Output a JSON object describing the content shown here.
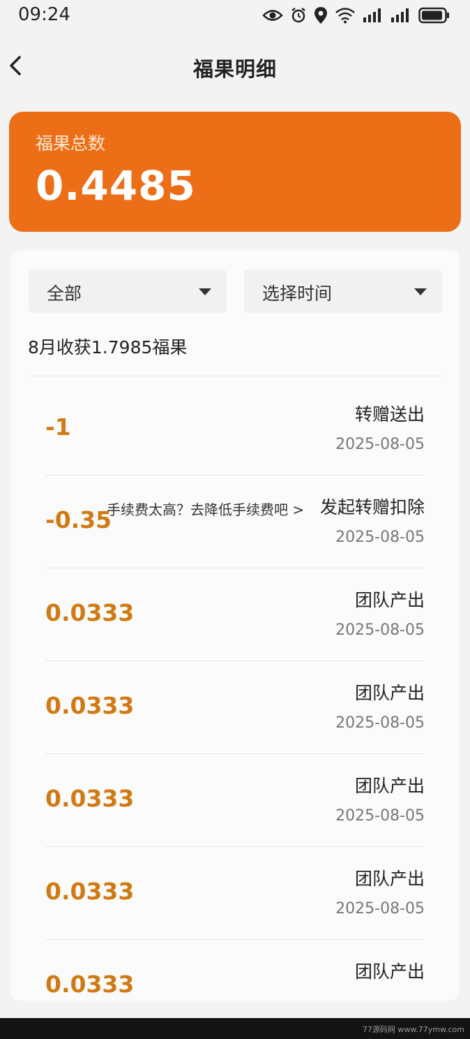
{
  "status_bar": {
    "time": "09:24",
    "icons": [
      "eye-icon",
      "alarm-icon",
      "location-icon",
      "wifi-icon",
      "signal-icon",
      "signal-icon",
      "battery-icon"
    ]
  },
  "header": {
    "title": "福果明细",
    "back_icon": "chevron-left-icon"
  },
  "summary_card": {
    "label": "福果总数",
    "value": "0.4485",
    "color": "#ec6e17"
  },
  "filters": {
    "type_label": "全部",
    "time_label": "选择时间"
  },
  "month_summary": "8月收获1.7985福果",
  "records": [
    {
      "amount": "-1",
      "type": "转赠送出",
      "date": "2025-08-05"
    },
    {
      "amount": "-0.35",
      "type": "发起转赠扣除",
      "date": "2025-08-05",
      "tip": "手续费太高？去降低手续费吧 >"
    },
    {
      "amount": "0.0333",
      "type": "团队产出",
      "date": "2025-08-05"
    },
    {
      "amount": "0.0333",
      "type": "团队产出",
      "date": "2025-08-05"
    },
    {
      "amount": "0.0333",
      "type": "团队产出",
      "date": "2025-08-05"
    },
    {
      "amount": "0.0333",
      "type": "团队产出",
      "date": "2025-08-05"
    },
    {
      "amount": "0.0333",
      "type": "团队产出",
      "date": ""
    }
  ],
  "watermark": "77源码网 www.77ymw.com",
  "colors": {
    "accent": "#ec6e17",
    "amount": "#d07a13"
  }
}
